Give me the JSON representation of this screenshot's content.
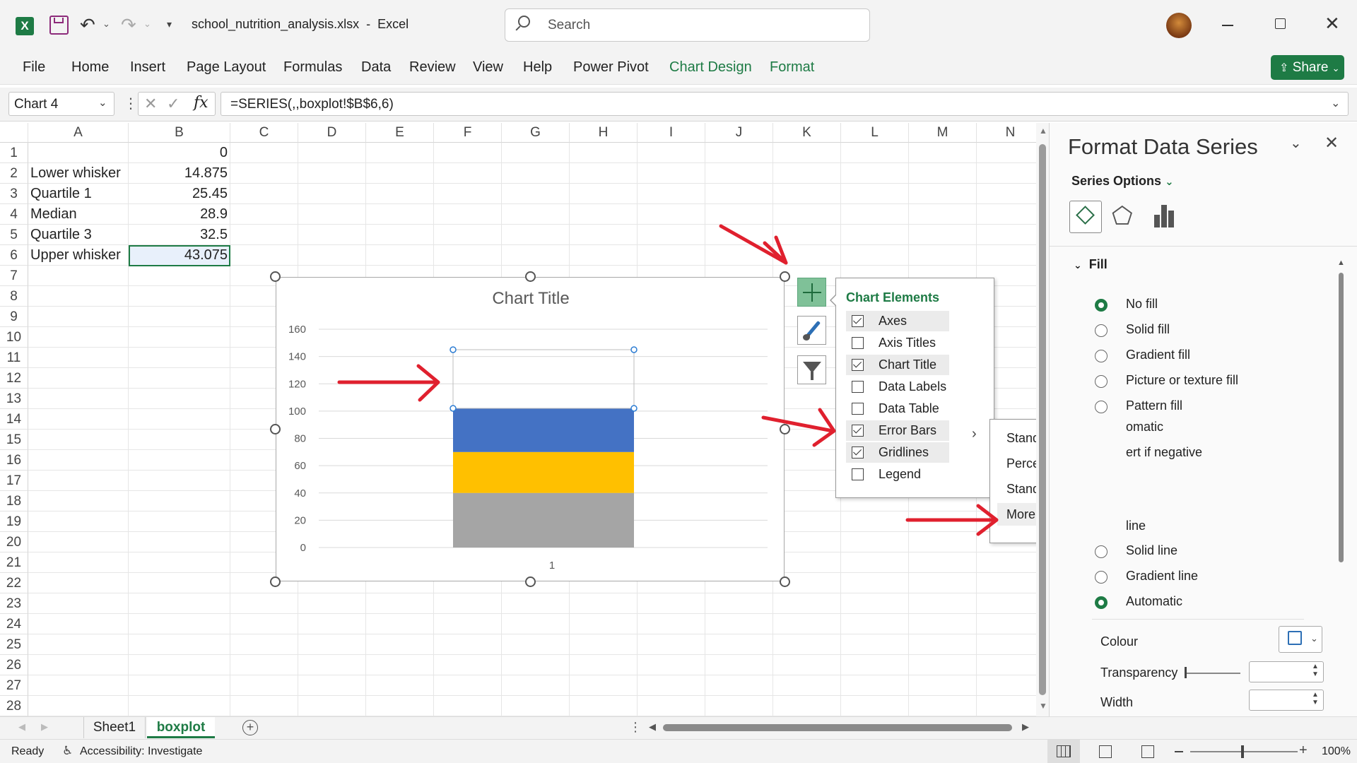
{
  "window": {
    "file_name": "school_nutrition_analysis.xlsx",
    "separator": "-",
    "app_name": "Excel",
    "search_placeholder": "Search"
  },
  "ribbon": {
    "tabs": [
      "File",
      "Home",
      "Insert",
      "Page Layout",
      "Formulas",
      "Data",
      "Review",
      "View",
      "Help",
      "Power Pivot",
      "Chart Design",
      "Format"
    ],
    "share_label": "Share"
  },
  "formula_bar": {
    "name_box": "Chart 4",
    "fx_label": "fx",
    "formula": "=SERIES(,,boxplot!$B$6,6)"
  },
  "sheet": {
    "columns": [
      "A",
      "B",
      "C",
      "D",
      "E",
      "F",
      "G",
      "H",
      "I",
      "J",
      "K",
      "L",
      "M",
      "N"
    ],
    "rows": [
      "1",
      "2",
      "3",
      "4",
      "5",
      "6",
      "7",
      "8",
      "9",
      "10",
      "11",
      "12",
      "13",
      "14",
      "15",
      "16",
      "17",
      "18",
      "19",
      "20",
      "21",
      "22",
      "23",
      "24",
      "25",
      "26",
      "27",
      "28"
    ],
    "cells": [
      {
        "a": "",
        "b": "0"
      },
      {
        "a": "Lower whisker",
        "b": "14.875"
      },
      {
        "a": "Quartile 1",
        "b": "25.45"
      },
      {
        "a": "Median",
        "b": "28.9"
      },
      {
        "a": "Quartile 3",
        "b": "32.5"
      },
      {
        "a": "Upper whisker",
        "b": "43.075"
      }
    ],
    "tabs": [
      "Sheet1",
      "boxplot"
    ]
  },
  "chart_data": {
    "type": "bar",
    "stacked": true,
    "title": "Chart Title",
    "categories": [
      "1"
    ],
    "ylim": [
      0,
      160
    ],
    "yticks": [
      "0",
      "20",
      "40",
      "60",
      "80",
      "100",
      "120",
      "140",
      "160"
    ],
    "grid": true,
    "series": [
      {
        "color": "#a5a5a5",
        "values": [
          40
        ]
      },
      {
        "color": "#ffc000",
        "values": [
          30
        ]
      },
      {
        "color": "#4472c4",
        "values": [
          32
        ]
      },
      {
        "color": "none",
        "values": [
          43
        ]
      }
    ]
  },
  "chart_elements": {
    "title": "Chart Elements",
    "items": [
      {
        "label": "Axes",
        "checked": true
      },
      {
        "label": "Axis Titles",
        "checked": false
      },
      {
        "label": "Chart Title",
        "checked": true
      },
      {
        "label": "Data Labels",
        "checked": false
      },
      {
        "label": "Data Table",
        "checked": false
      },
      {
        "label": "Error Bars",
        "checked": true
      },
      {
        "label": "Gridlines",
        "checked": true
      },
      {
        "label": "Legend",
        "checked": false
      }
    ],
    "submenu_arrow": "›"
  },
  "error_bars_submenu": [
    "Standard Error",
    "Percentage",
    "Standard Deviation",
    "More Options..."
  ],
  "format_pane": {
    "title": "Format Data Series",
    "series_options_label": "Series Options",
    "fill_section": "Fill",
    "fill_options": [
      {
        "label": "No fill",
        "selected": true
      },
      {
        "label": "Solid fill",
        "selected": false
      },
      {
        "label": "Gradient fill",
        "selected": false
      },
      {
        "label": "Picture or texture fill",
        "selected": false
      },
      {
        "label": "Pattern fill",
        "selected": false
      }
    ],
    "partial_automatic": "omatic",
    "partial_invert": "ert if negative",
    "partial_line": "line",
    "line_options": [
      {
        "label": "Solid line",
        "selected": false
      },
      {
        "label": "Gradient line",
        "selected": false
      },
      {
        "label": "Automatic",
        "selected": true
      }
    ],
    "colour_label": "Colour",
    "transparency_label": "Transparency",
    "width_label": "Width"
  },
  "status": {
    "ready": "Ready",
    "accessibility": "Accessibility: Investigate",
    "zoom": "100%"
  },
  "colors": {
    "excel_green": "#1e7b45",
    "arrow_red": "#e0202e"
  }
}
